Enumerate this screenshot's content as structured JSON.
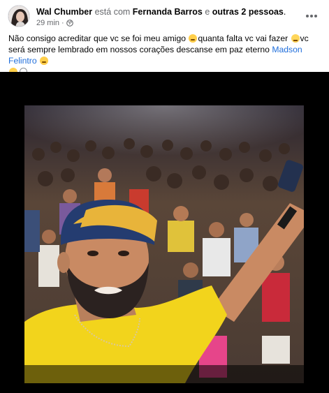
{
  "post": {
    "author": "Wal Chumber",
    "with_text": "está com",
    "tagged_person": "Fernanda Barros",
    "and_text": "e",
    "others": "outras 2 pessoas",
    "period": ".",
    "time": "29 min",
    "separator": "·",
    "privacy_icon": "globe-icon",
    "more_icon": "more-options-icon",
    "text_part1": "Não consigo acreditar que vc se foi meu amigo ",
    "text_part2": "quanta falta vc vai fazer ",
    "text_part3": "vc será sempre lembrado em nossos corações descanse em paz eterno ",
    "mention": "Madson Felintro"
  },
  "media": {
    "background": "#000000",
    "description_colors": {
      "shirt": "#f2d41c",
      "cap": "#243c70",
      "cap_brim": "#e8b43a",
      "skin": "#c98a63",
      "crowd": "#5a4234"
    }
  },
  "colors": {
    "link": "#216fdb",
    "muted": "#65676b",
    "text": "#050505"
  }
}
